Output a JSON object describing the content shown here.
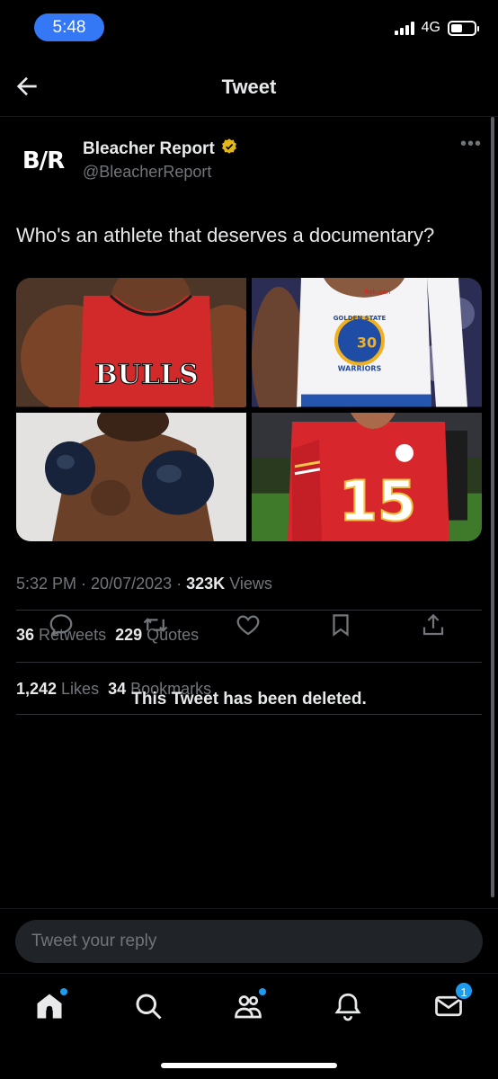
{
  "status_bar": {
    "time": "5:48",
    "network": "4G"
  },
  "header": {
    "title": "Tweet",
    "back_icon": "arrow-left-icon"
  },
  "tweet": {
    "author_name": "Bleacher Report",
    "author_handle": "@BleacherReport",
    "avatar_text": "B/R",
    "verified_color": "#e2b719",
    "text": "Who's an athlete that deserves a documentary?",
    "timestamp": "5:32 PM · 20/07/2023 ·",
    "views_count": "323K",
    "views_label": "Views",
    "stats": {
      "retweets_count": "36",
      "retweets_label": "Retweets",
      "quotes_count": "229",
      "quotes_label": "Quotes",
      "likes_count": "1,242",
      "likes_label": "Likes",
      "bookmarks_count": "34",
      "bookmarks_label": "Bookmarks"
    },
    "media": {
      "tile1": {
        "jersey_text": "BULLS"
      },
      "tile2": {
        "jersey_text": "WARRIORS",
        "number": "30",
        "sponsor": "Rakuten",
        "arc_text": "GOLDEN STATE"
      },
      "tile3": {},
      "tile4": {
        "number": "15"
      }
    }
  },
  "deleted_notice": "This Tweet has been deleted.",
  "reply": {
    "placeholder": "Tweet your reply"
  },
  "nav": {
    "messages_badge": "1"
  },
  "colors": {
    "accent": "#1d9bf0",
    "background": "#000000",
    "muted": "#71767b"
  }
}
